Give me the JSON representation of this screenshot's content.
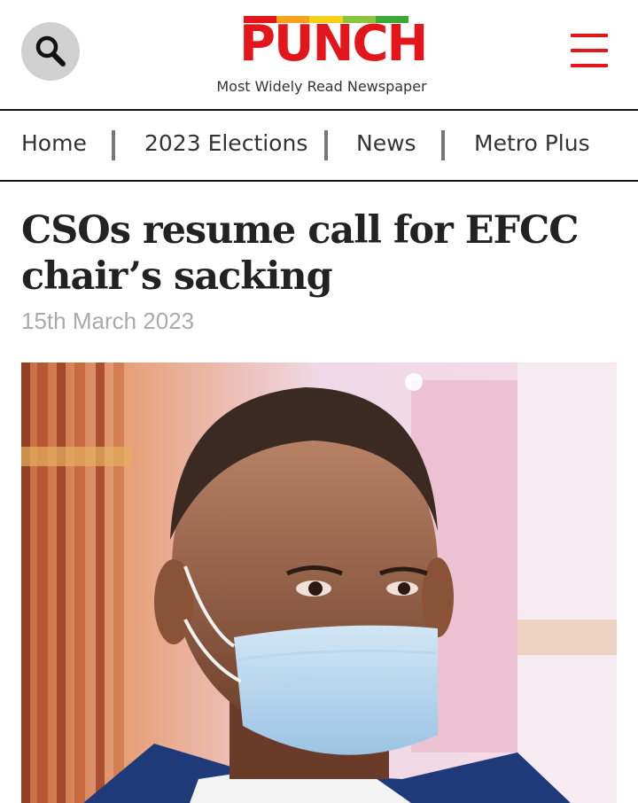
{
  "header": {
    "logo_text": "PUNCH",
    "tagline": "Most Widely Read Newspaper",
    "logo_stripe_colors": [
      "#e3161b",
      "#f7a21b",
      "#f7d117",
      "#8cc63f",
      "#3aa935"
    ],
    "brand_color": "#e3161b",
    "search_icon": "search-icon",
    "menu_icon": "hamburger-menu-icon"
  },
  "nav": {
    "items": [
      {
        "label": "Home"
      },
      {
        "label": "2023 Elections"
      },
      {
        "label": "News"
      },
      {
        "label": "Metro Plus"
      }
    ]
  },
  "article": {
    "headline": "CSOs resume call for EFCC chair’s sacking",
    "date": "15th March 2023"
  }
}
